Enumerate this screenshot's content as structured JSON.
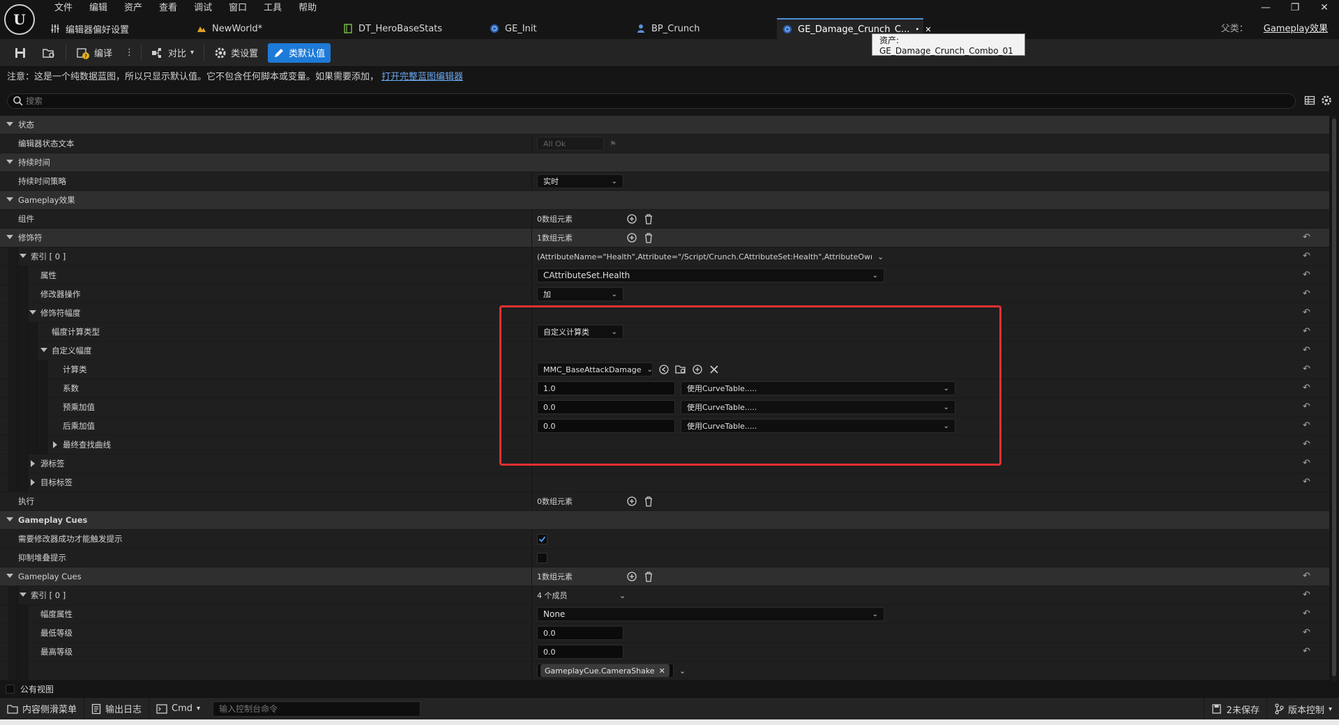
{
  "app": {
    "logo": "U",
    "menu": [
      "文件",
      "编辑",
      "资产",
      "查看",
      "调试",
      "窗口",
      "工具",
      "帮助"
    ],
    "tabs": [
      {
        "label": "编辑器偏好设置",
        "icon": "sliders-icon"
      },
      {
        "label": "NewWorld*",
        "icon": "level-icon"
      },
      {
        "label": "DT_HeroBaseStats",
        "icon": "datatable-icon"
      },
      {
        "label": "GE_Init",
        "icon": "blueprint-icon"
      },
      {
        "label": "BP_Crunch",
        "icon": "character-icon"
      },
      {
        "label": "GE_Damage_Crunch_C...",
        "icon": "blueprint-icon",
        "active": true
      }
    ],
    "parent_label": "父类：",
    "parent_value": "Gameplay效果",
    "tooltip": "资产: GE_Damage_Crunch_Combo_01"
  },
  "toolbar": {
    "compile": "编译",
    "diff": "对比",
    "class_settings": "类设置",
    "class_defaults": "类默认值"
  },
  "notice": {
    "text": "注意：这是一个纯数据蓝图，所以只显示默认值。它不包含任何脚本或变量。如果需要添加，",
    "link": "打开完整蓝图编辑器"
  },
  "search": {
    "placeholder": "搜索"
  },
  "props": {
    "status_section": "状态",
    "editor_status_text": "编辑器状态文本",
    "editor_status_value": "All Ok",
    "duration_section": "持续时间",
    "duration_policy": "持续时间策略",
    "duration_policy_value": "实时",
    "gameplay_effect_section": "Gameplay效果",
    "components": "组件",
    "components_value": "0数组元素",
    "modifiers": "修饰符",
    "modifiers_value": "1数组元素",
    "index0": "索引 [ 0 ]",
    "index0_value": "(AttributeName=\"Health\",Attribute=\"/Script/Crunch.CAttributeSet:Health\",AttributeOwner=\"/",
    "attribute": "属性",
    "attribute_value": "CAttributeSet.Health",
    "modifier_op": "修改器操作",
    "modifier_op_value": "加",
    "modifier_magnitude": "修饰符幅度",
    "magnitude_calc_type": "幅度计算类型",
    "magnitude_calc_type_value": "自定义计算类",
    "custom_magnitude": "自定义幅度",
    "calc_class": "计算类",
    "calc_class_value": "MMC_BaseAttackDamage",
    "coefficient": "系数",
    "coefficient_value": "1.0",
    "pre_multiply": "预乘加值",
    "pre_multiply_value": "0.0",
    "post_multiply": "后乘加值",
    "post_multiply_value": "0.0",
    "curve_table": "使用CurveTable.....",
    "final_lookup_curve": "最终查找曲线",
    "source_tags": "源标签",
    "target_tags": "目标标签",
    "executions": "执行",
    "executions_value": "0数组元素",
    "cues_section": "Gameplay Cues",
    "require_modifier_success": "需要修改器成功才能触发提示",
    "suppress_stacking": "抑制堆叠提示",
    "cues": "Gameplay Cues",
    "cues_value": "1数组元素",
    "cue_index0": "索引 [ 0 ]",
    "cue_index0_value": "4 个成员",
    "magnitude_attribute": "幅度属性",
    "magnitude_attribute_value": "None",
    "min_level": "最低等级",
    "min_level_value": "0.0",
    "max_level": "最高等级",
    "max_level_value": "0.0",
    "cue_tag": "GameplayCue.CameraShake"
  },
  "public_view": "公有视图",
  "statusbar": {
    "content_drawer": "内容侧滑菜单",
    "output_log": "输出日志",
    "cmd": "Cmd",
    "cmd_placeholder": "输入控制台命令",
    "unsaved": "2未保存",
    "source_control": "版本控制"
  },
  "colors": {
    "accent": "#1e7ad8",
    "highlight": "#e53030",
    "check": "#4a9ae8"
  }
}
